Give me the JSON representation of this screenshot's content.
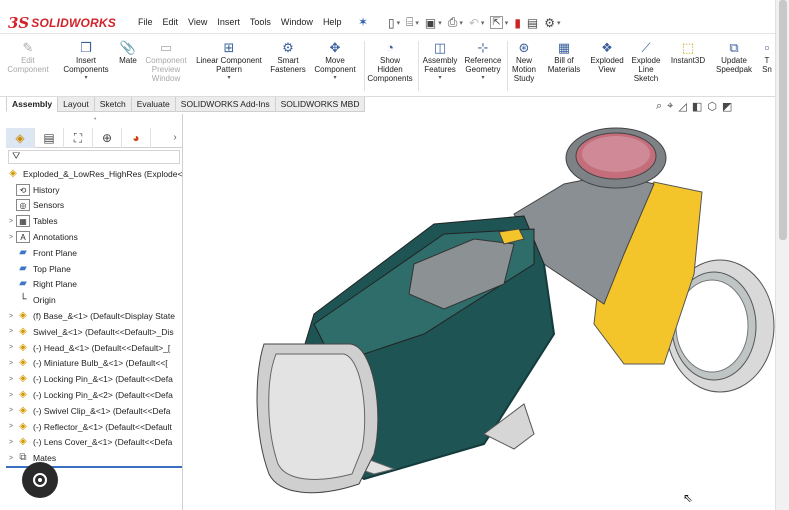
{
  "app": {
    "logo_mark": "3S",
    "logo_text": "SOLIDWORKS"
  },
  "menu": [
    "File",
    "Edit",
    "View",
    "Insert",
    "Tools",
    "Window",
    "Help"
  ],
  "ribbon": {
    "commands": [
      {
        "label": "Edit\nComponent",
        "icon": "edit-component-icon",
        "disabled": true
      },
      {
        "label": "Insert\nComponents",
        "icon": "insert-components-icon",
        "disabled": false
      },
      {
        "label": "Mate",
        "icon": "mate-icon",
        "disabled": false
      },
      {
        "label": "Component\nPreview\nWindow",
        "icon": "component-preview-icon",
        "disabled": true
      },
      {
        "label": "Linear Component\nPattern",
        "icon": "linear-pattern-icon",
        "disabled": false
      },
      {
        "label": "Smart\nFasteners",
        "icon": "smart-fasteners-icon",
        "disabled": false
      },
      {
        "label": "Move\nComponent",
        "icon": "move-component-icon",
        "disabled": false
      },
      {
        "label": "Show\nHidden\nComponents",
        "icon": "show-hidden-icon",
        "disabled": false
      },
      {
        "label": "Assembly\nFeatures",
        "icon": "assembly-features-icon",
        "disabled": false
      },
      {
        "label": "Reference\nGeometry",
        "icon": "reference-geometry-icon",
        "disabled": false
      },
      {
        "label": "New\nMotion\nStudy",
        "icon": "motion-study-icon",
        "disabled": false
      },
      {
        "label": "Bill of\nMaterials",
        "icon": "bom-icon",
        "disabled": false
      },
      {
        "label": "Exploded\nView",
        "icon": "exploded-view-icon",
        "disabled": false
      },
      {
        "label": "Explode\nLine\nSketch",
        "icon": "explode-line-icon",
        "disabled": false
      },
      {
        "label": "Instant3D",
        "icon": "instant3d-icon",
        "disabled": false
      },
      {
        "label": "Update\nSpeedpak",
        "icon": "speedpak-icon",
        "disabled": false
      },
      {
        "label": "T\nSn",
        "icon": "snapshot-icon",
        "disabled": false
      }
    ]
  },
  "tabs": [
    "Assembly",
    "Layout",
    "Sketch",
    "Evaluate",
    "SOLIDWORKS Add-Ins",
    "SOLIDWORKS MBD"
  ],
  "tree": {
    "root": "Exploded_&_LowRes_HighRes  (Explode<D",
    "items": [
      {
        "text": "History",
        "icon": "history-icon",
        "expand": ""
      },
      {
        "text": "Sensors",
        "icon": "sensors-icon",
        "expand": ""
      },
      {
        "text": "Tables",
        "icon": "tables-icon",
        "expand": ">"
      },
      {
        "text": "Annotations",
        "icon": "annotations-icon",
        "expand": ">"
      },
      {
        "text": "Front Plane",
        "icon": "plane-icon",
        "expand": ""
      },
      {
        "text": "Top Plane",
        "icon": "plane-icon",
        "expand": ""
      },
      {
        "text": "Right Plane",
        "icon": "plane-icon",
        "expand": ""
      },
      {
        "text": "Origin",
        "icon": "origin-icon",
        "expand": ""
      },
      {
        "text": "(f) Base_&<1> (Default<Display State",
        "icon": "part-icon",
        "expand": ">"
      },
      {
        "text": "Swivel_&<1> (Default<<Default>_Dis",
        "icon": "part-icon",
        "expand": ">"
      },
      {
        "text": "(-) Head_&<1> (Default<<Default>_[",
        "icon": "part-icon",
        "expand": ">"
      },
      {
        "text": "(-) Miniature Bulb_&<1> (Default<<[",
        "icon": "part-icon",
        "expand": ">"
      },
      {
        "text": "(-) Locking Pin_&<1> (Default<<Defa",
        "icon": "part-icon",
        "expand": ">"
      },
      {
        "text": "(-) Locking Pin_&<2> (Default<<Defa",
        "icon": "part-icon",
        "expand": ">"
      },
      {
        "text": "(-) Swivel Clip_&<1> (Default<<Defa",
        "icon": "part-icon",
        "expand": ">"
      },
      {
        "text": "(-) Reflector_&<1> (Default<<Default",
        "icon": "part-icon",
        "expand": ">"
      },
      {
        "text": "(-) Lens Cover_&<1> (Default<<Defa",
        "icon": "part-icon",
        "expand": ">"
      },
      {
        "text": "Mates",
        "icon": "mates-icon",
        "expand": ">"
      }
    ]
  }
}
